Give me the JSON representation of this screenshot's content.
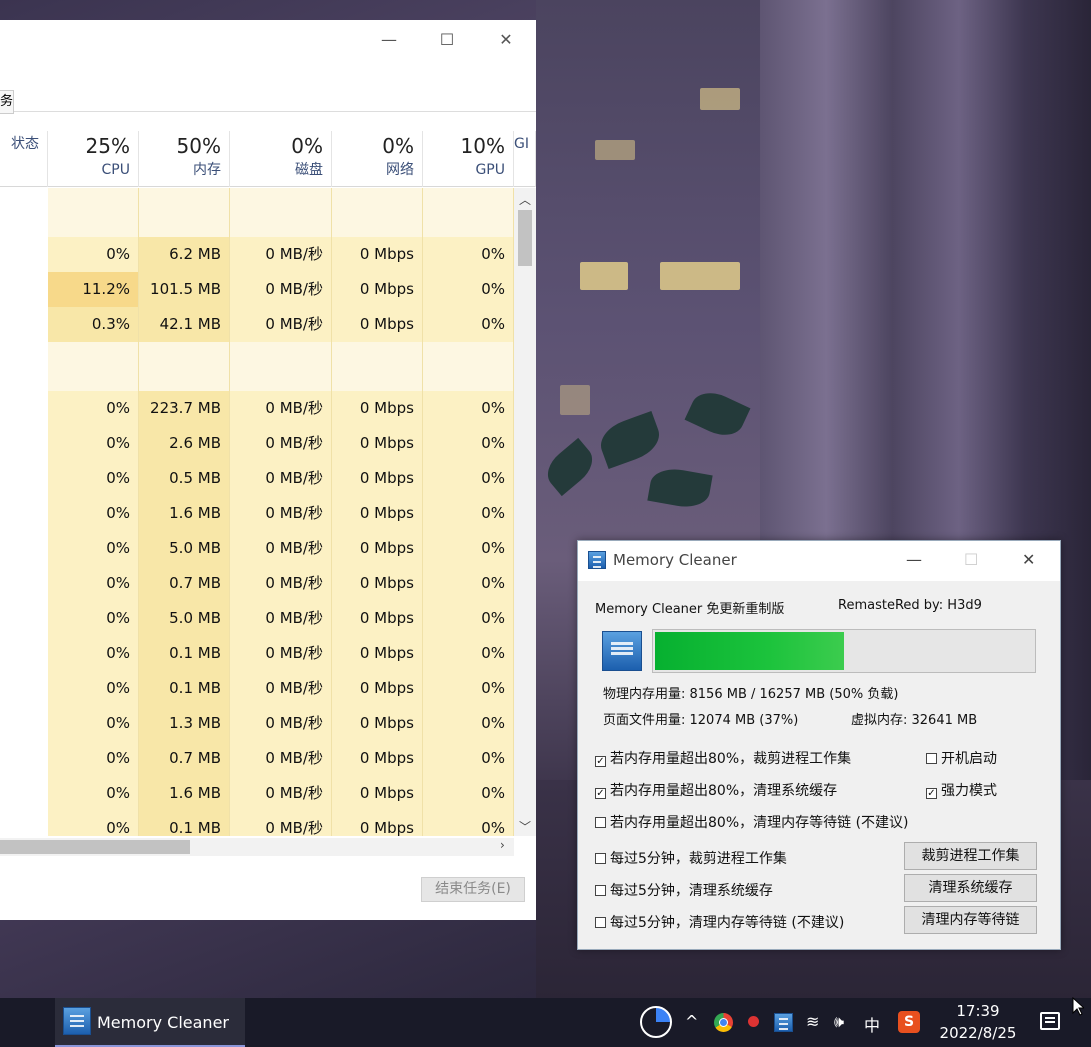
{
  "task_manager": {
    "title_controls": {
      "minimize": "—",
      "maximize": "☐",
      "close": "✕"
    },
    "tab_fragment": "务",
    "columns": [
      {
        "pct": "",
        "label": "状态"
      },
      {
        "pct": "25%",
        "label": "CPU"
      },
      {
        "pct": "50%",
        "label": "内存"
      },
      {
        "pct": "0%",
        "label": "磁盘"
      },
      {
        "pct": "0%",
        "label": "网络"
      },
      {
        "pct": "10%",
        "label": "GPU"
      },
      {
        "pct": "",
        "label": "GI"
      }
    ],
    "rows": [
      {
        "cpu": "",
        "mem": "",
        "disk": "",
        "net": "",
        "gpu": "",
        "group": true
      },
      {
        "cpu": "0%",
        "mem": "6.2 MB",
        "disk": "0 MB/秒",
        "net": "0 Mbps",
        "gpu": "0%"
      },
      {
        "cpu": "11.2%",
        "mem": "101.5 MB",
        "disk": "0 MB/秒",
        "net": "0 Mbps",
        "gpu": "0%",
        "hot": true
      },
      {
        "cpu": "0.3%",
        "mem": "42.1 MB",
        "disk": "0 MB/秒",
        "net": "0 Mbps",
        "gpu": "0%",
        "warm": true
      },
      {
        "cpu": "",
        "mem": "",
        "disk": "",
        "net": "",
        "gpu": "",
        "group": true,
        "tall": true
      },
      {
        "cpu": "0%",
        "mem": "223.7 MB",
        "disk": "0 MB/秒",
        "net": "0 Mbps",
        "gpu": "0%"
      },
      {
        "cpu": "0%",
        "mem": "2.6 MB",
        "disk": "0 MB/秒",
        "net": "0 Mbps",
        "gpu": "0%"
      },
      {
        "cpu": "0%",
        "mem": "0.5 MB",
        "disk": "0 MB/秒",
        "net": "0 Mbps",
        "gpu": "0%"
      },
      {
        "cpu": "0%",
        "mem": "1.6 MB",
        "disk": "0 MB/秒",
        "net": "0 Mbps",
        "gpu": "0%"
      },
      {
        "cpu": "0%",
        "mem": "5.0 MB",
        "disk": "0 MB/秒",
        "net": "0 Mbps",
        "gpu": "0%"
      },
      {
        "cpu": "0%",
        "mem": "0.7 MB",
        "disk": "0 MB/秒",
        "net": "0 Mbps",
        "gpu": "0%"
      },
      {
        "cpu": "0%",
        "mem": "5.0 MB",
        "disk": "0 MB/秒",
        "net": "0 Mbps",
        "gpu": "0%"
      },
      {
        "cpu": "0%",
        "mem": "0.1 MB",
        "disk": "0 MB/秒",
        "net": "0 Mbps",
        "gpu": "0%"
      },
      {
        "cpu": "0%",
        "mem": "0.1 MB",
        "disk": "0 MB/秒",
        "net": "0 Mbps",
        "gpu": "0%"
      },
      {
        "cpu": "0%",
        "mem": "1.3 MB",
        "disk": "0 MB/秒",
        "net": "0 Mbps",
        "gpu": "0%"
      },
      {
        "cpu": "0%",
        "mem": "0.7 MB",
        "disk": "0 MB/秒",
        "net": "0 Mbps",
        "gpu": "0%"
      },
      {
        "cpu": "0%",
        "mem": "1.6 MB",
        "disk": "0 MB/秒",
        "net": "0 Mbps",
        "gpu": "0%"
      },
      {
        "cpu": "0%",
        "mem": "0.1 MB",
        "disk": "0 MB/秒",
        "net": "0 Mbps",
        "gpu": "0%"
      }
    ],
    "end_task_label": "结束任务(E)",
    "colors": {
      "cell": "#fcf1c4",
      "cell_mem": "#f8e7a8",
      "cell_hot": "#f7d98a",
      "group": "#fdf7e2"
    }
  },
  "memory_cleaner": {
    "window_title": "Memory Cleaner",
    "title_controls": {
      "minimize": "—",
      "maximize": "☐",
      "close": "✕"
    },
    "header_left": "Memory Cleaner 免更新重制版",
    "header_right": "RemasteRed by: H3d9",
    "usage_fraction": 0.5,
    "physical_line": "物理内存用量: 8156 MB  /  16257 MB  (50% 负载)",
    "page_file_line": "页面文件用量: 12074 MB (37%)",
    "virtual_line": "虚拟内存: 32641 MB",
    "options": [
      {
        "label": "若内存用量超出80%，裁剪进程工作集",
        "checked": true
      },
      {
        "label": "若内存用量超出80%，清理系统缓存",
        "checked": true
      },
      {
        "label": "若内存用量超出80%，清理内存等待链 (不建议)",
        "checked": false
      }
    ],
    "side_options": [
      {
        "label": "开机启动",
        "checked": false
      },
      {
        "label": "强力模式",
        "checked": true
      }
    ],
    "timed_options": [
      {
        "label": "每过5分钟，裁剪进程工作集",
        "checked": false
      },
      {
        "label": "每过5分钟，清理系统缓存",
        "checked": false
      },
      {
        "label": "每过5分钟，清理内存等待链 (不建议)",
        "checked": false
      }
    ],
    "buttons": [
      "裁剪进程工作集",
      "清理系统缓存",
      "清理内存等待链"
    ]
  },
  "taskbar": {
    "app_label": "Memory Cleaner",
    "tray": {
      "ime": "中",
      "volume": "🕪",
      "wifi": "≋",
      "chevron": "^"
    },
    "time": "17:39",
    "date": "2022/8/25"
  }
}
